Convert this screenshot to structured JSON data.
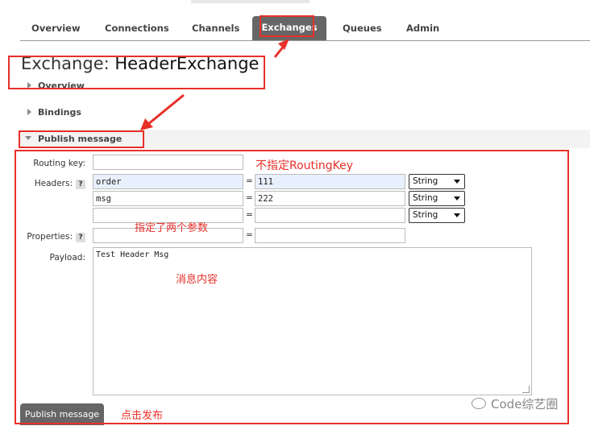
{
  "nav": {
    "tabs": [
      "Overview",
      "Connections",
      "Channels",
      "Exchanges",
      "Queues",
      "Admin"
    ],
    "active": "Exchanges"
  },
  "page": {
    "title_prefix": "Exchange: ",
    "title_name": "HeaderExchange"
  },
  "sections": {
    "overview": "Overview",
    "bindings": "Bindings",
    "publish": "Publish message"
  },
  "form": {
    "routing_key_label": "Routing key:",
    "routing_key_value": "",
    "headers_label": "Headers:",
    "help": "?",
    "headers": [
      {
        "key": "order",
        "value": "111",
        "type": "String"
      },
      {
        "key": "msg",
        "value": "222",
        "type": "String"
      },
      {
        "key": "",
        "value": "",
        "type": "String"
      }
    ],
    "eq": "=",
    "properties_label": "Properties:",
    "payload_label": "Payload:",
    "payload_value": "Test Header Msg",
    "publish_button": "Publish message"
  },
  "annotations": {
    "no_routing_key": "不指定RoutingKey",
    "two_params": "指定了两个参数",
    "message_content": "消息内容",
    "click_publish": "点击发布"
  },
  "watermark": "Code综艺圈",
  "colors": {
    "annotation_red": "#e8302a",
    "active_tab": "#666666",
    "filled_input": "#e8f0fe"
  }
}
